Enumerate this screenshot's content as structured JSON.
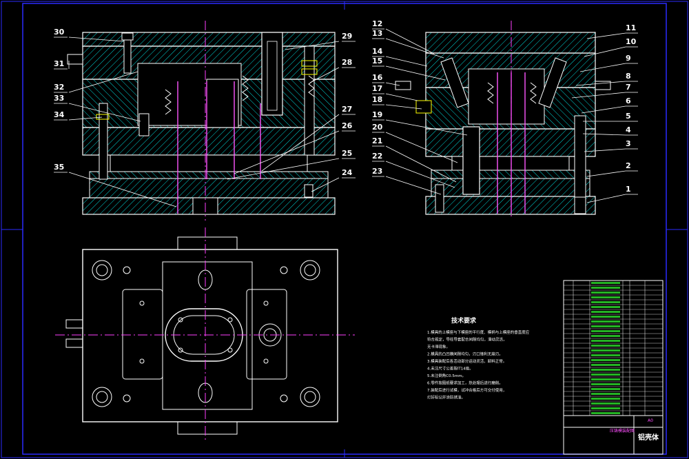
{
  "colors": {
    "background": "#000000",
    "border": "#2b2bff",
    "outline": "#ffffff",
    "hatch": "#00d7d7",
    "centerline": "#ff40ff",
    "pin": "#ff55ff",
    "spring": "#ffffff",
    "accent": "#ffff00",
    "table_text": "#33ff33"
  },
  "left_section_labels": [
    {
      "num": "30"
    },
    {
      "num": "31"
    },
    {
      "num": "32"
    },
    {
      "num": "33"
    },
    {
      "num": "34"
    },
    {
      "num": "35"
    },
    {
      "num": "29"
    },
    {
      "num": "28"
    },
    {
      "num": "27"
    },
    {
      "num": "26"
    },
    {
      "num": "25"
    },
    {
      "num": "24"
    }
  ],
  "right_section_labels": [
    {
      "num": "12"
    },
    {
      "num": "13"
    },
    {
      "num": "14"
    },
    {
      "num": "15"
    },
    {
      "num": "16"
    },
    {
      "num": "17"
    },
    {
      "num": "18"
    },
    {
      "num": "19"
    },
    {
      "num": "20"
    },
    {
      "num": "21"
    },
    {
      "num": "22"
    },
    {
      "num": "23"
    },
    {
      "num": "11"
    },
    {
      "num": "10"
    },
    {
      "num": "9"
    },
    {
      "num": "8"
    },
    {
      "num": "7"
    },
    {
      "num": "6"
    },
    {
      "num": "5"
    },
    {
      "num": "4"
    },
    {
      "num": "3"
    },
    {
      "num": "2"
    },
    {
      "num": "1"
    }
  ],
  "tech_requirements": {
    "title": "技术要求",
    "lines": [
      "1.模具的上模座与下模座的平行度、模柄与上模座的垂直度应",
      "  符合规定，导柱导套配合间隙均匀，滑动灵活，",
      "  无卡滞现象。",
      "2.模具的凸凹模间隙均匀，刃口锋利无崩刃。",
      "3.模具装配后各活动部分运动灵活，卸料正常。",
      "4.未注尺寸公差按IT14级。",
      "5.未注倒角C0.5mm。",
      "6.零件按图纸要求加工，热处理后进行磨削。",
      "7.装配后进行试模，试冲合格后方可交付使用，",
      "  打好标记并涂防锈油。"
    ]
  },
  "title_block": {
    "drawing_name": "压铸模装配图",
    "title": "铝壳体",
    "unit": "A0"
  }
}
